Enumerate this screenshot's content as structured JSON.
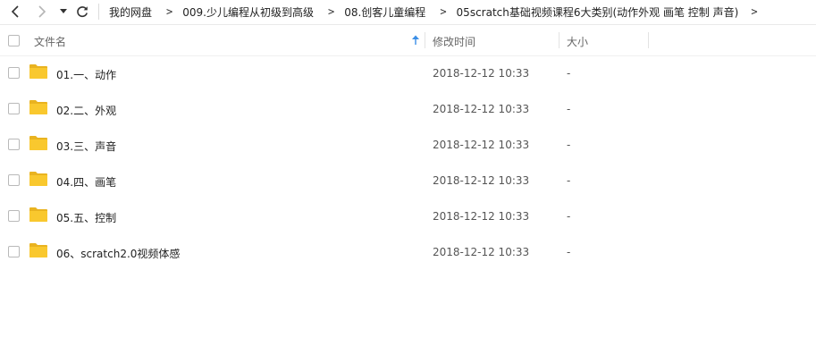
{
  "toolbar": {
    "back_icon": "chevron-left-icon",
    "forward_icon": "chevron-right-icon",
    "history_icon": "caret-down-icon",
    "refresh_icon": "refresh-icon"
  },
  "breadcrumb": {
    "items": [
      "我的网盘",
      "009.少儿编程从初级到高级",
      "08.创客儿童编程",
      "05scratch基础视频课程6大类别(动作外观  画笔 控制 声音)"
    ],
    "separator": ">"
  },
  "table": {
    "columns": {
      "name": "文件名",
      "modified": "修改时间",
      "size": "大小"
    },
    "sort_icon": "sort-up-arrow-icon",
    "rows": [
      {
        "name": "01.一、动作",
        "modified": "2018-12-12 10:33",
        "size": "-"
      },
      {
        "name": "02.二、外观",
        "modified": "2018-12-12 10:33",
        "size": "-"
      },
      {
        "name": "03.三、声音",
        "modified": "2018-12-12 10:33",
        "size": "-"
      },
      {
        "name": "04.四、画笔",
        "modified": "2018-12-12 10:33",
        "size": "-"
      },
      {
        "name": "05.五、控制",
        "modified": "2018-12-12 10:33",
        "size": "-"
      },
      {
        "name": "06、scratch2.0视频体感",
        "modified": "2018-12-12 10:33",
        "size": "-"
      }
    ]
  },
  "colors": {
    "folder": "#f9c82e",
    "folder_dark": "#e9b320",
    "accent": "#3a8ee6"
  }
}
